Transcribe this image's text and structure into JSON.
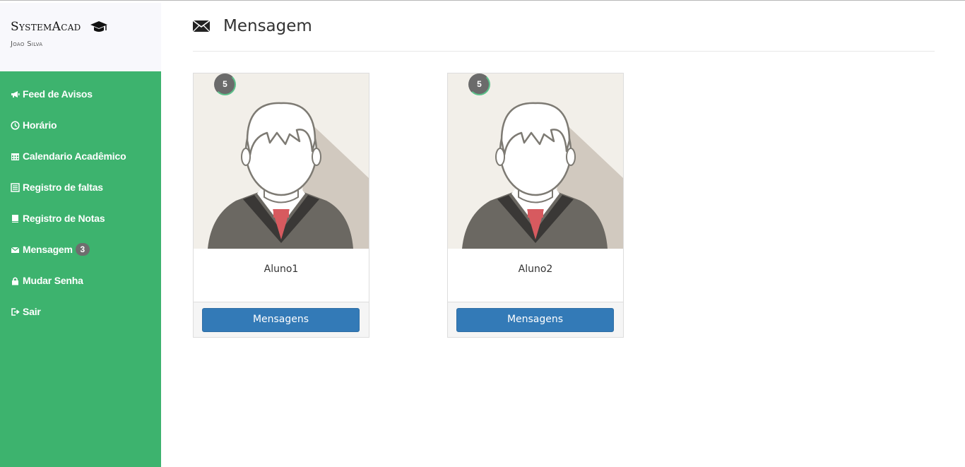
{
  "brand": {
    "title": "SystemAcad",
    "user": "Joao Silva"
  },
  "sidebar": {
    "items": [
      {
        "label": "Feed de Avisos",
        "icon": "bullhorn-icon"
      },
      {
        "label": "Horário",
        "icon": "clock-icon"
      },
      {
        "label": "Calendario Acadêmico",
        "icon": "calendar-icon"
      },
      {
        "label": "Registro de faltas",
        "icon": "list-icon"
      },
      {
        "label": "Registro de Notas",
        "icon": "book-icon"
      },
      {
        "label": "Mensagem",
        "icon": "envelope-icon",
        "badge": "3"
      },
      {
        "label": "Mudar Senha",
        "icon": "lock-icon"
      },
      {
        "label": "Sair",
        "icon": "logout-icon"
      }
    ]
  },
  "header": {
    "title": "Mensagem"
  },
  "cards": [
    {
      "name": "Aluno1",
      "badge": "5",
      "button": "Mensagens"
    },
    {
      "name": "Aluno2",
      "badge": "5",
      "button": "Mensagens"
    }
  ],
  "colors": {
    "sidebar": "#3db36e",
    "button": "#337ab7",
    "badge": "#6b6b6b"
  }
}
